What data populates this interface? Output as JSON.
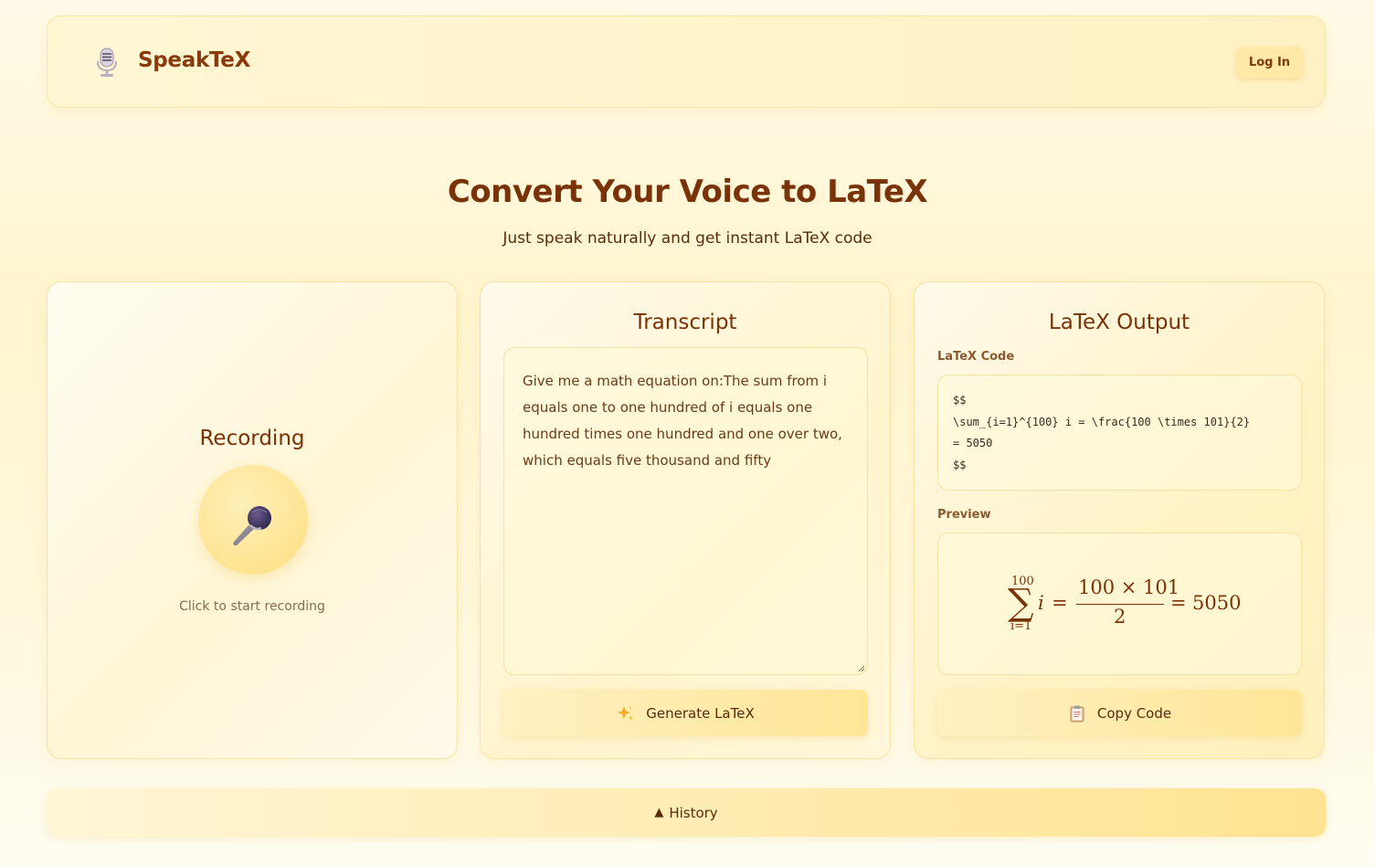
{
  "header": {
    "logo_icon": "studio-microphone-icon",
    "app_name": "SpeakTeX",
    "login_label": "Log In"
  },
  "hero": {
    "title": "Convert Your Voice to LaTeX",
    "subtitle": "Just speak naturally and get instant LaTeX code"
  },
  "recording": {
    "title": "Recording",
    "mic_icon": "microphone-icon",
    "hint": "Click to start recording"
  },
  "transcript": {
    "title": "Transcript",
    "text": "Give me a math equation on:The sum from i equals one to one hundred of i equals one hundred times one hundred and one over two, which equals five thousand and fifty",
    "generate_label": "Generate LaTeX",
    "generate_icon": "sparkles-icon"
  },
  "latex": {
    "title": "LaTeX Output",
    "code_label": "LaTeX Code",
    "code": "$$\n\\sum_{i=1}^{100} i = \\frac{100 \\times 101}{2}\n= 5050\n$$",
    "preview_label": "Preview",
    "preview": {
      "upper": "100",
      "sigma": "∑",
      "lower": "i=1",
      "var": "i",
      "eq1": "=",
      "numerator": "100 × 101",
      "denominator": "2",
      "eq2": "=",
      "result": "5050"
    },
    "copy_label": "Copy Code",
    "copy_icon": "clipboard-icon"
  },
  "history": {
    "arrow": "▲",
    "label": "History"
  },
  "colors": {
    "brand_text": "#7a3208",
    "accent": "#ffe391",
    "background": "#fff5cf"
  }
}
